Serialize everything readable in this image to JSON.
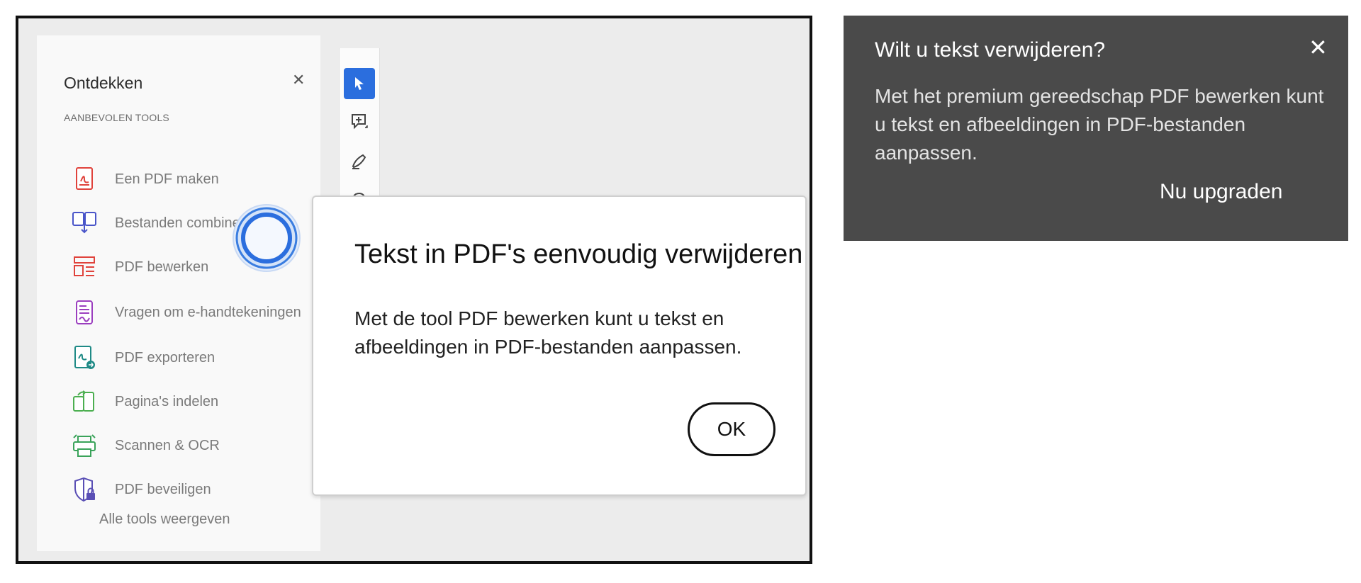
{
  "sidebar": {
    "title": "Ontdekken",
    "close_icon": "close-icon",
    "section_label": "AANBEVOLEN TOOLS",
    "items": [
      {
        "label": "Een PDF maken",
        "icon": "create-pdf-icon",
        "color": "#e0433c"
      },
      {
        "label": "Bestanden combineren",
        "icon": "combine-files-icon",
        "color": "#4a55c9"
      },
      {
        "label": "PDF bewerken",
        "icon": "edit-pdf-icon",
        "color": "#e0433c"
      },
      {
        "label": "Vragen om e-handtekeningen",
        "icon": "request-signatures-icon",
        "color": "#9b3fbf"
      },
      {
        "label": "PDF exporteren",
        "icon": "export-pdf-icon",
        "color": "#1f8a86"
      },
      {
        "label": "Pagina's indelen",
        "icon": "organize-pages-icon",
        "color": "#4caf50"
      },
      {
        "label": "Scannen & OCR",
        "icon": "scan-ocr-icon",
        "color": "#3aa35a"
      },
      {
        "label": "PDF beveiligen",
        "icon": "protect-pdf-icon",
        "color": "#5a4fb5"
      }
    ],
    "all_tools": "Alle tools weergeven"
  },
  "toolbar": {
    "tools": [
      "select-tool-icon",
      "add-comment-icon",
      "draw-icon",
      "lasso-icon"
    ],
    "active_color": "#2b6ede"
  },
  "popup": {
    "title": "Tekst in PDF's eenvoudig verwijderen",
    "body": "Met de tool PDF bewerken kunt u tekst en afbeeldingen in PDF-bestanden aanpassen.",
    "ok_label": "OK"
  },
  "tooltip": {
    "title": "Wilt u tekst verwijderen?",
    "body": "Met het premium gereedschap PDF bewerken kunt u tekst en afbeeldingen in PDF-bestanden aanpassen.",
    "upgrade_label": "Nu upgraden",
    "close_glyph": "✕",
    "background": "#4a4a4a"
  }
}
